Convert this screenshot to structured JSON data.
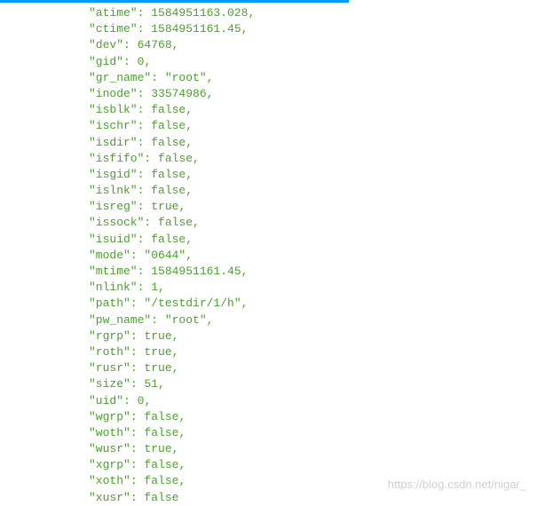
{
  "progress_percent": 65,
  "watermark": "https://blog.csdn.net/nigar_",
  "json_entries": [
    {
      "key": "atime",
      "value": "1584951163.028",
      "type": "number",
      "comma": true
    },
    {
      "key": "ctime",
      "value": "1584951161.45",
      "type": "number",
      "comma": true
    },
    {
      "key": "dev",
      "value": "64768",
      "type": "number",
      "comma": true
    },
    {
      "key": "gid",
      "value": "0",
      "type": "number",
      "comma": true
    },
    {
      "key": "gr_name",
      "value": "root",
      "type": "string",
      "comma": true
    },
    {
      "key": "inode",
      "value": "33574986",
      "type": "number",
      "comma": true
    },
    {
      "key": "isblk",
      "value": "false",
      "type": "boolean",
      "comma": true
    },
    {
      "key": "ischr",
      "value": "false",
      "type": "boolean",
      "comma": true
    },
    {
      "key": "isdir",
      "value": "false",
      "type": "boolean",
      "comma": true
    },
    {
      "key": "isfifo",
      "value": "false",
      "type": "boolean",
      "comma": true
    },
    {
      "key": "isgid",
      "value": "false",
      "type": "boolean",
      "comma": true
    },
    {
      "key": "islnk",
      "value": "false",
      "type": "boolean",
      "comma": true
    },
    {
      "key": "isreg",
      "value": "true",
      "type": "boolean",
      "comma": true
    },
    {
      "key": "issock",
      "value": "false",
      "type": "boolean",
      "comma": true
    },
    {
      "key": "isuid",
      "value": "false",
      "type": "boolean",
      "comma": true
    },
    {
      "key": "mode",
      "value": "0644",
      "type": "string",
      "comma": true
    },
    {
      "key": "mtime",
      "value": "1584951161.45",
      "type": "number",
      "comma": true
    },
    {
      "key": "nlink",
      "value": "1",
      "type": "number",
      "comma": true
    },
    {
      "key": "path",
      "value": "/testdir/1/h",
      "type": "string",
      "comma": true
    },
    {
      "key": "pw_name",
      "value": "root",
      "type": "string",
      "comma": true
    },
    {
      "key": "rgrp",
      "value": "true",
      "type": "boolean",
      "comma": true
    },
    {
      "key": "roth",
      "value": "true",
      "type": "boolean",
      "comma": true
    },
    {
      "key": "rusr",
      "value": "true",
      "type": "boolean",
      "comma": true
    },
    {
      "key": "size",
      "value": "51",
      "type": "number",
      "comma": true
    },
    {
      "key": "uid",
      "value": "0",
      "type": "number",
      "comma": true
    },
    {
      "key": "wgrp",
      "value": "false",
      "type": "boolean",
      "comma": true
    },
    {
      "key": "woth",
      "value": "false",
      "type": "boolean",
      "comma": true
    },
    {
      "key": "wusr",
      "value": "true",
      "type": "boolean",
      "comma": true
    },
    {
      "key": "xgrp",
      "value": "false",
      "type": "boolean",
      "comma": true
    },
    {
      "key": "xoth",
      "value": "false",
      "type": "boolean",
      "comma": true
    },
    {
      "key": "xusr",
      "value": "false",
      "type": "boolean",
      "comma": false
    }
  ]
}
